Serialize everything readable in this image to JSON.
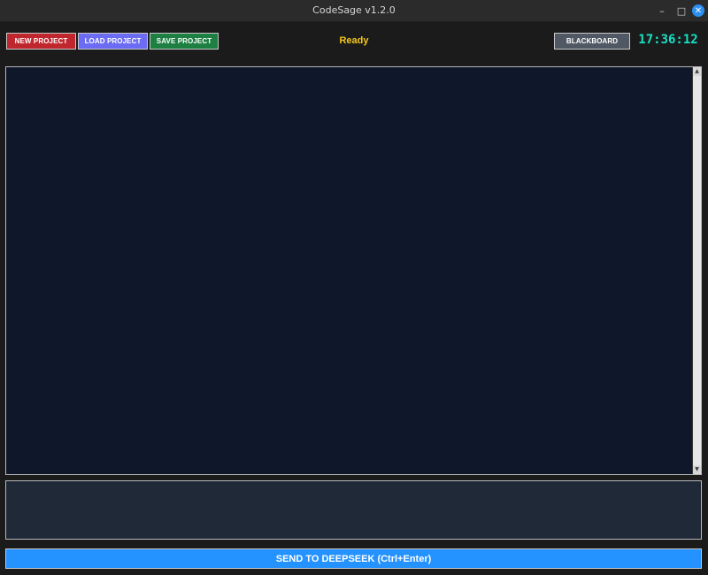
{
  "window": {
    "title": "CodeSage v1.2.0",
    "controls": {
      "minimize_glyph": "–",
      "maximize_glyph": "□",
      "close_glyph": "✕"
    }
  },
  "toolbar": {
    "new_project_label": "NEW PROJECT",
    "load_project_label": "LOAD PROJECT",
    "save_project_label": "SAVE PROJECT",
    "status_text": "Ready",
    "blackboard_label": "BLACKBOARD",
    "clock": "17:36:12"
  },
  "output": {
    "text": ""
  },
  "input": {
    "value": ""
  },
  "send": {
    "label": "SEND TO DEEPSEEK (Ctrl+Enter)"
  },
  "colors": {
    "new_project": "#c0262d",
    "load_project": "#6b6cf3",
    "save_project": "#1d8042",
    "blackboard": "#505864",
    "status": "#f4c61d",
    "clock": "#16e0c4",
    "send": "#2492ff",
    "output_bg": "#0f172a",
    "input_bg": "#1f2937"
  },
  "icons": {
    "minimize": "minimize-icon",
    "maximize": "maximize-icon",
    "close": "close-icon",
    "scroll_up": "arrow-up-icon",
    "scroll_down": "arrow-down-icon"
  }
}
